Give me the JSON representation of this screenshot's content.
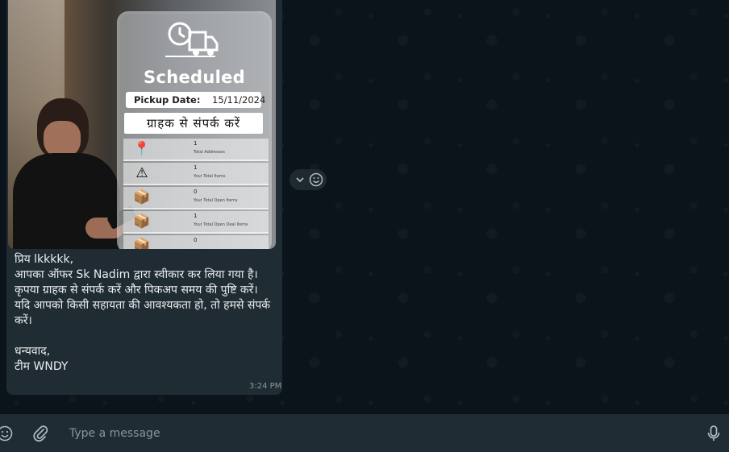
{
  "message": {
    "image": {
      "card_title": "Scheduled",
      "pickup_label": "Pickup Date:",
      "pickup_value": "15/11/2024",
      "contact_text": "ग्राहक से संपर्क करें",
      "stats": [
        {
          "icon": "location-pin-icon",
          "glyph": "📍",
          "value": "1",
          "label": "Total Addresses"
        },
        {
          "icon": "warning-box-icon",
          "glyph": "⚠",
          "value": "1",
          "label": "Your Total Items"
        },
        {
          "icon": "box-icon",
          "glyph": "📦",
          "value": "0",
          "label": "Your Total Open Items"
        },
        {
          "icon": "deal-box-icon",
          "glyph": "📦",
          "value": "1",
          "label": "Your Total Open Deal Items"
        },
        {
          "icon": "box-icon",
          "glyph": "📦",
          "value": "0",
          "label": ""
        }
      ]
    },
    "text": "प्रिय lkkkkk,\nआपका ऑफर Sk Nadim द्वारा स्वीकार कर लिया गया है।\nकृपया ग्राहक से संपर्क करें और पिकअप समय की पुष्टि करें।\nयदि आपको किसी सहायता की आवश्यकता हो, तो हमसे संपर्क करें।\n\nधन्यवाद,\nटीम WNDY",
    "time": "3:24 PM"
  },
  "compose": {
    "placeholder": "Type a message"
  },
  "colors": {
    "chat_background": "#0b141a",
    "bubble": "#202c33",
    "text": "#e9edef",
    "muted": "#8696a0"
  }
}
